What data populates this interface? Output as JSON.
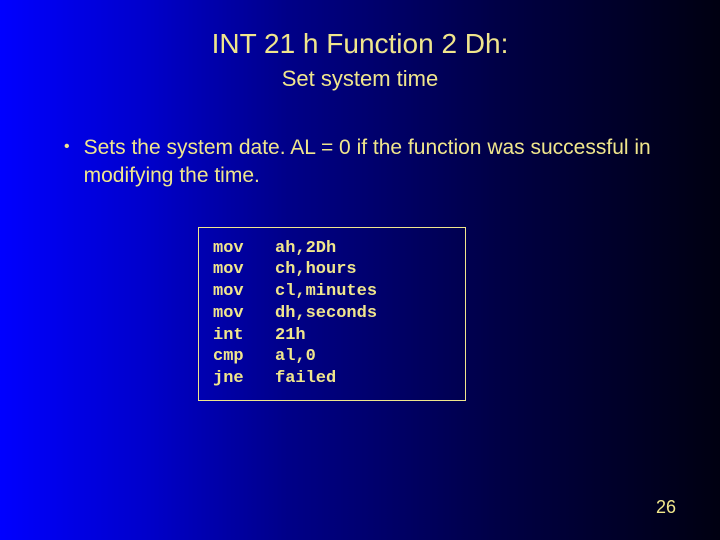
{
  "title": "INT 21 h Function 2 Dh:",
  "subtitle": "Set system time",
  "bullet": {
    "marker": "•",
    "text": "Sets the system date. AL = 0 if the function was successful in modifying the time."
  },
  "code": [
    {
      "op": "mov",
      "arg": "ah,2Dh"
    },
    {
      "op": "mov",
      "arg": "ch,hours"
    },
    {
      "op": "mov",
      "arg": "cl,minutes"
    },
    {
      "op": "mov",
      "arg": "dh,seconds"
    },
    {
      "op": "int",
      "arg": "21h"
    },
    {
      "op": "cmp",
      "arg": "al,0"
    },
    {
      "op": "jne",
      "arg": "failed"
    }
  ],
  "page_number": "26"
}
